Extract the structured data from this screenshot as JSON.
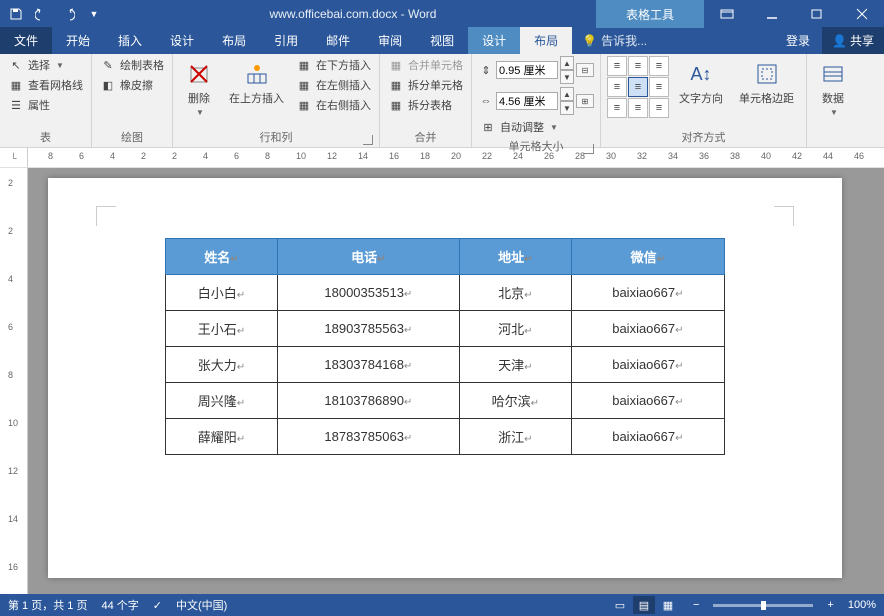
{
  "title": {
    "doc": "www.officebai.com.docx - Word",
    "context": "表格工具"
  },
  "tabs": {
    "file": "文件",
    "home": "开始",
    "insert": "插入",
    "design": "设计",
    "layout": "布局",
    "references": "引用",
    "mailings": "邮件",
    "review": "审阅",
    "view": "视图",
    "tbl_design": "设计",
    "tbl_layout": "布局",
    "tell_me": "告诉我...",
    "login": "登录",
    "share": "共享"
  },
  "ribbon": {
    "g_table": {
      "label": "表",
      "select": "选择",
      "gridlines": "查看网格线",
      "properties": "属性"
    },
    "g_draw": {
      "label": "绘图",
      "draw": "绘制表格",
      "eraser": "橡皮擦"
    },
    "g_rowscols": {
      "label": "行和列",
      "delete": "删除",
      "insert_above": "在上方插入",
      "insert_below": "在下方插入",
      "insert_left": "在左侧插入",
      "insert_right": "在右侧插入"
    },
    "g_merge": {
      "label": "合并",
      "merge": "合并单元格",
      "split_cells": "拆分单元格",
      "split_table": "拆分表格"
    },
    "g_size": {
      "label": "单元格大小",
      "height": "0.95 厘米",
      "width": "4.56 厘米",
      "autofit": "自动调整"
    },
    "g_align": {
      "label": "对齐方式",
      "text_dir": "文字方向",
      "margins": "单元格边距"
    },
    "g_data": {
      "label": "",
      "data": "数据"
    }
  },
  "ruler_h": [
    "8",
    "6",
    "4",
    "2",
    "2",
    "4",
    "6",
    "8",
    "10",
    "12",
    "14",
    "16",
    "18",
    "20",
    "22",
    "24",
    "26",
    "28",
    "30",
    "32",
    "34",
    "36",
    "38",
    "40",
    "42",
    "44",
    "46"
  ],
  "ruler_v": [
    "2",
    "2",
    "4",
    "6",
    "8",
    "10",
    "12",
    "14",
    "16"
  ],
  "doctable": {
    "headers": [
      "姓名",
      "电话",
      "地址",
      "微信"
    ],
    "rows": [
      [
        "白小白",
        "18000353513",
        "北京",
        "baixiao667"
      ],
      [
        "王小石",
        "18903785563",
        "河北",
        "baixiao667"
      ],
      [
        "张大力",
        "18303784168",
        "天津",
        "baixiao667"
      ],
      [
        "周兴隆",
        "18103786890",
        "哈尔滨",
        "baixiao667"
      ],
      [
        "薛耀阳",
        "18783785063",
        "浙江",
        "baixiao667"
      ]
    ]
  },
  "status": {
    "page": "第 1 页，共 1 页",
    "words": "44 个字",
    "lang": "中文(中国)",
    "zoom": "100%"
  }
}
